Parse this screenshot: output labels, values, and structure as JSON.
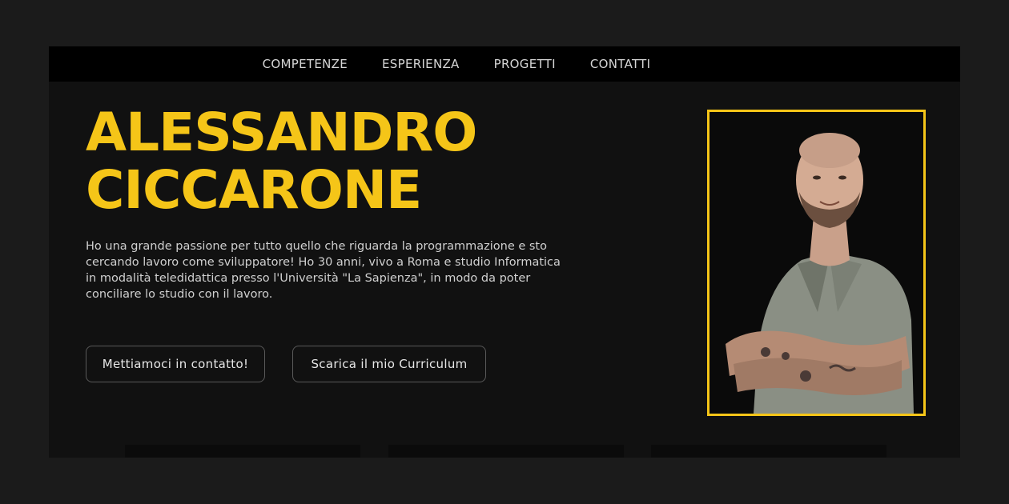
{
  "nav": {
    "items": [
      {
        "label": "COMPETENZE"
      },
      {
        "label": "ESPERIENZA"
      },
      {
        "label": "PROGETTI"
      },
      {
        "label": "CONTATTI"
      }
    ]
  },
  "hero": {
    "name_line1": "ALESSANDRO",
    "name_line2": "CICCARONE",
    "bio": "Ho una grande passione per tutto quello che riguarda la programmazione e sto cercando lavoro come sviluppatore! Ho 30 anni, vivo a Roma e studio Informatica in modalità teledidattica presso l'Università \"La Sapienza\", in modo da poter conciliare lo studio con il lavoro.",
    "contact_button": "Mettiamoci in contatto!",
    "cv_button": "Scarica il mio Curriculum"
  },
  "colors": {
    "accent": "#f5c518",
    "background": "#111111",
    "page_background": "#1b1b1b",
    "nav_background": "#000000"
  }
}
